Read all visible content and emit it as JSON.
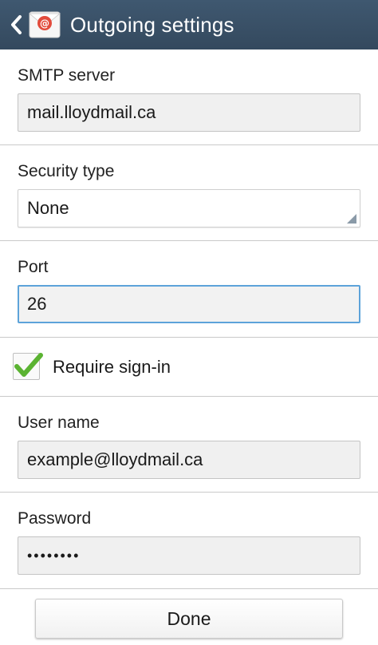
{
  "header": {
    "title": "Outgoing settings",
    "back_icon": "chevron-left-icon",
    "app_icon": "email-app-icon",
    "bar_color": "#3a5065"
  },
  "form": {
    "smtp_server": {
      "label": "SMTP server",
      "value": "mail.lloydmail.ca"
    },
    "security_type": {
      "label": "Security type",
      "value": "None"
    },
    "port": {
      "label": "Port",
      "value": "26"
    },
    "require_sign_in": {
      "label": "Require sign-in",
      "checked": true
    },
    "user_name": {
      "label": "User name",
      "value": "example@lloydmail.ca"
    },
    "password": {
      "label": "Password",
      "value": "••••••••"
    }
  },
  "actions": {
    "done_label": "Done"
  },
  "colors": {
    "focus_border": "#5da3da",
    "check_green": "#5bb332"
  }
}
